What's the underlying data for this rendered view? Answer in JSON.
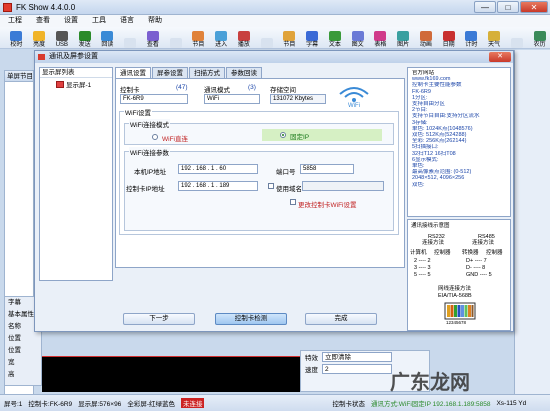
{
  "app": {
    "title": "FK Show 4.4.0.0",
    "min": "—",
    "max": "□",
    "close": "✕"
  },
  "menu": [
    "工程",
    "查看",
    "设置",
    "工具",
    "语言",
    "帮助"
  ],
  "toolbar": [
    {
      "label": "校时",
      "color": "#3b7bd6"
    },
    {
      "label": "亮度",
      "color": "#f0b429"
    },
    {
      "label": "USB",
      "color": "#555555"
    },
    {
      "label": "发送",
      "color": "#2a8a2a"
    },
    {
      "label": "回读",
      "color": "#3a8ad6"
    },
    {
      "label": "",
      "color": "#d8e2ef"
    },
    {
      "label": "查看",
      "color": "#7a5fd0"
    },
    {
      "label": "",
      "color": "#d8e2ef"
    },
    {
      "label": "节目",
      "color": "#e0823a"
    },
    {
      "label": "进入",
      "color": "#4aa0d8"
    },
    {
      "label": "播放",
      "color": "#c84040"
    },
    {
      "label": "",
      "color": "#d8e2ef"
    },
    {
      "label": "节目",
      "color": "#e0a33a"
    },
    {
      "label": "字幕",
      "color": "#3a6ad6"
    },
    {
      "label": "文本",
      "color": "#3a9a3a"
    },
    {
      "label": "图文",
      "color": "#6a7ad6"
    },
    {
      "label": "表格",
      "color": "#d03a8a"
    },
    {
      "label": "图片",
      "color": "#3aa0a0"
    },
    {
      "label": "动画",
      "color": "#d06a3a"
    },
    {
      "label": "日期",
      "color": "#c83030"
    },
    {
      "label": "计时",
      "color": "#3a7ad6"
    },
    {
      "label": "天气",
      "color": "#d6b03a"
    },
    {
      "label": "",
      "color": "#d8e2ef"
    },
    {
      "label": "农历",
      "color": "#3a8a5a"
    }
  ],
  "left_pane": {
    "title": "单屏节目",
    "prop_rows": [
      "字幕",
      "基本属性",
      "名称",
      "位置",
      "位置",
      "宽",
      "高"
    ]
  },
  "effect_panel": {
    "rows": [
      {
        "label": "特效",
        "value": "立即清除"
      },
      {
        "label": "速度",
        "value": "2"
      }
    ]
  },
  "status": {
    "screen": "屏号:1",
    "card": "控制卡:FK-6R9",
    "display": "显示屏:576×96",
    "color": "全彩屏-红绿蓝色",
    "connect": "未连接",
    "card_status": "控制卡状态",
    "comm": "通讯方式:WiFi固定IP 192.168.1.189:5858",
    "zoom": "Xs-115 Yd"
  },
  "dialog": {
    "title": "通讯及屏参设置",
    "close": "✕",
    "screen_list_header": "显示屏列表",
    "screens": [
      "显示屏-1"
    ],
    "tabs": [
      "通讯设置",
      "屏参设置",
      "扫描方式",
      "参数回读"
    ],
    "card_label": "控制卡",
    "card_count": "(47)",
    "card_value": "FK-6R9",
    "comm_label": "通讯模式",
    "comm_count": "(3)",
    "comm_value": "WiFi",
    "storage_label": "存储空间",
    "storage_value": "131072 Kbytes",
    "wifi_group": "WiFi设置",
    "wifi_mode_group": "WiFi连接模式",
    "wifi_direct": "WiFi直连",
    "fixed_ip": "固定IP",
    "wifi_params_group": "WiFi连接参数",
    "local_ip_label": "本机IP地址",
    "local_ip": "192 . 168 . 1 . 60",
    "port_label": "端口号",
    "port": "5858",
    "card_ip_label": "控制卡IP地址",
    "card_ip": "192 . 168 . 1 . 189",
    "use_domain": "使用域名",
    "change_wifi": "更改控制卡WiFi设置",
    "btn_next": "下一步",
    "btn_detect": "控制卡检测",
    "btn_done": "完成",
    "info_lines": [
      "官方网站",
      "www.fk169.com",
      "控制卡主要性能参数",
      "FK-6R9",
      "1分区:",
      "  支持自由分区",
      "2节目:",
      "  支持节目自由:支持分区流水",
      "3存储:",
      "  单色: 1024K点(1048576)",
      "  双色: 512K点(524288)",
      "  全彩: 256K点(262144)",
      "5扫描接口:",
      "  32扫T12 16扫T08",
      "6显示模式:",
      "  单色:",
      "  最高像素点范围: (0-512)",
      "  2048×512, 4096×256",
      "  双色:"
    ],
    "wire_title": "通讯接线示意图",
    "rs232": "RS232",
    "rs232_sub": "连接方法",
    "rs485": "RS485",
    "rs485_sub": "连接方法",
    "pc_label": "计算机",
    "ctrl_label": "控制器",
    "conv_label": "转换器",
    "ctrl_label2": "控制器",
    "rs232_rows": [
      "2 ---- 2",
      "3 ---- 3",
      "5 ---- 5"
    ],
    "rs485_rows": [
      "D+ ---- 7",
      "D- ---- 8",
      "GND ---- 5"
    ],
    "net_title": "网线连接方法",
    "net_sub": "EIA/TIA-568B",
    "net_pins": "12345678"
  },
  "watermark": "广东龙网"
}
